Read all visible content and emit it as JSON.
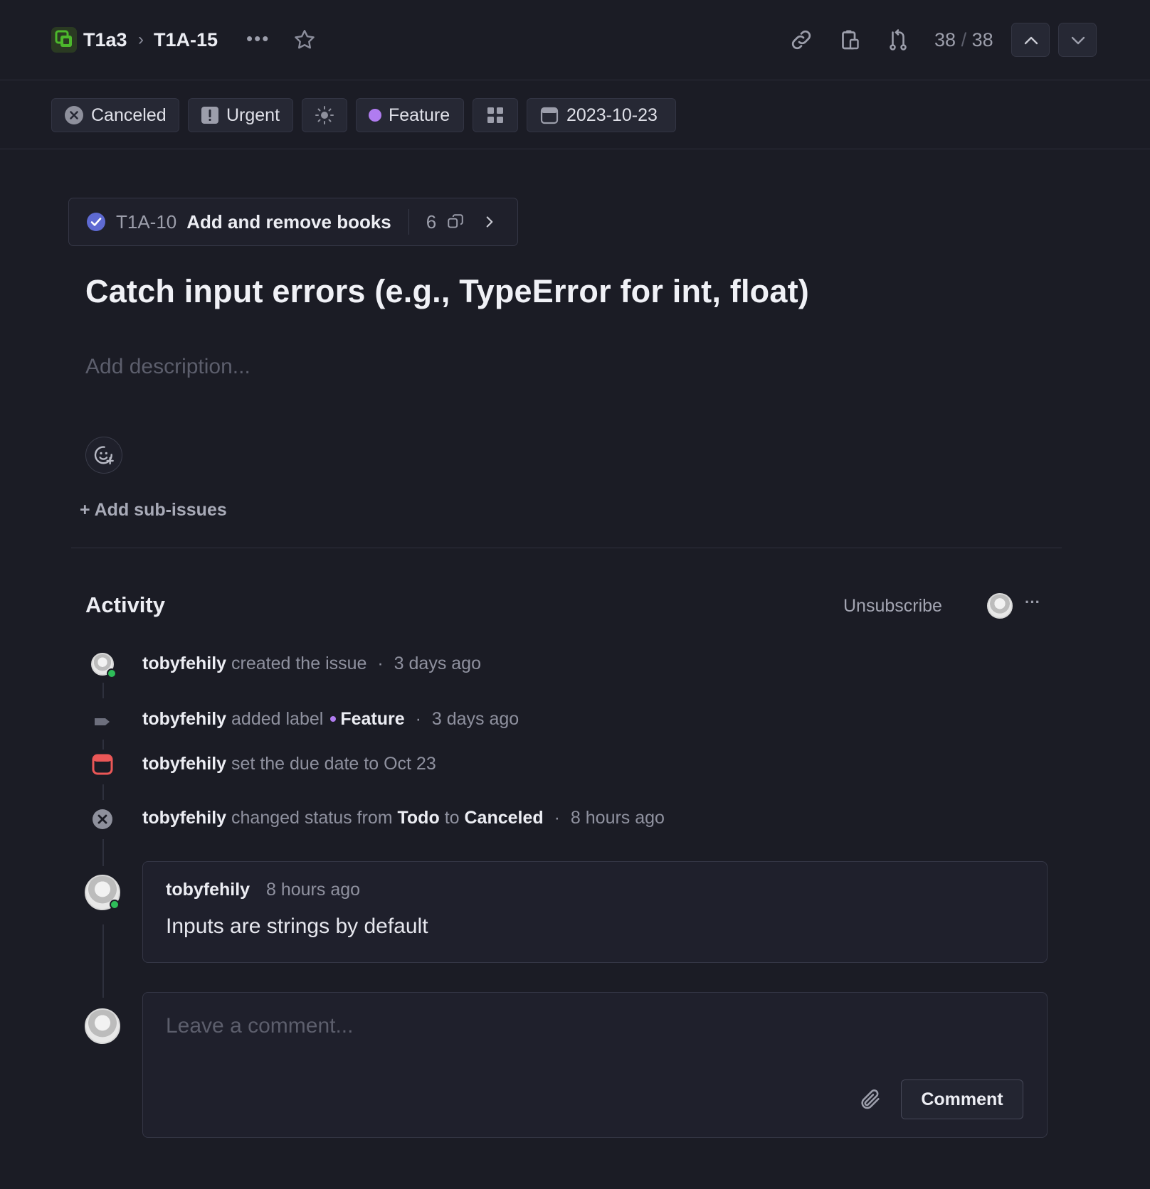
{
  "header": {
    "project": "T1a3",
    "separator": "›",
    "issue_id": "T1A-15",
    "more": "•••",
    "counter_current": "38",
    "counter_sep": "/",
    "counter_total": "38"
  },
  "properties": {
    "status": "Canceled",
    "priority": "Urgent",
    "label": "Feature",
    "due_date": "2023-10-23"
  },
  "parent": {
    "id": "T1A-10",
    "title": "Add and remove books",
    "count": "6"
  },
  "issue": {
    "title": "Catch input errors (e.g., TypeError for int, float)",
    "description_placeholder": "Add description..."
  },
  "sub_issues": {
    "add_label": "+ Add sub-issues"
  },
  "activity": {
    "title": "Activity",
    "unsubscribe": "Unsubscribe",
    "more": "···",
    "events": [
      {
        "user": "tobyfehily",
        "action": "created the issue",
        "sep": "·",
        "time": "3 days ago"
      },
      {
        "user": "tobyfehily",
        "action": "added label",
        "label": "Feature",
        "sep": "·",
        "time": "3 days ago"
      },
      {
        "user": "tobyfehily",
        "action": "set the due date to Oct 23"
      },
      {
        "user": "tobyfehily",
        "action": "changed status from",
        "from": "Todo",
        "to_word": "to",
        "to": "Canceled",
        "sep": "·",
        "time": "8 hours ago"
      }
    ],
    "comment": {
      "author": "tobyfehily",
      "time": "8 hours ago",
      "body": "Inputs are strings by default"
    },
    "editor": {
      "placeholder": "Leave a comment...",
      "submit": "Comment"
    }
  },
  "colors": {
    "label_feature": "#b07cf0",
    "online": "#2ebd59",
    "parent_done": "#5e6ad2",
    "due_icon": "#eb5757",
    "project_icon": "#4cb82c"
  }
}
